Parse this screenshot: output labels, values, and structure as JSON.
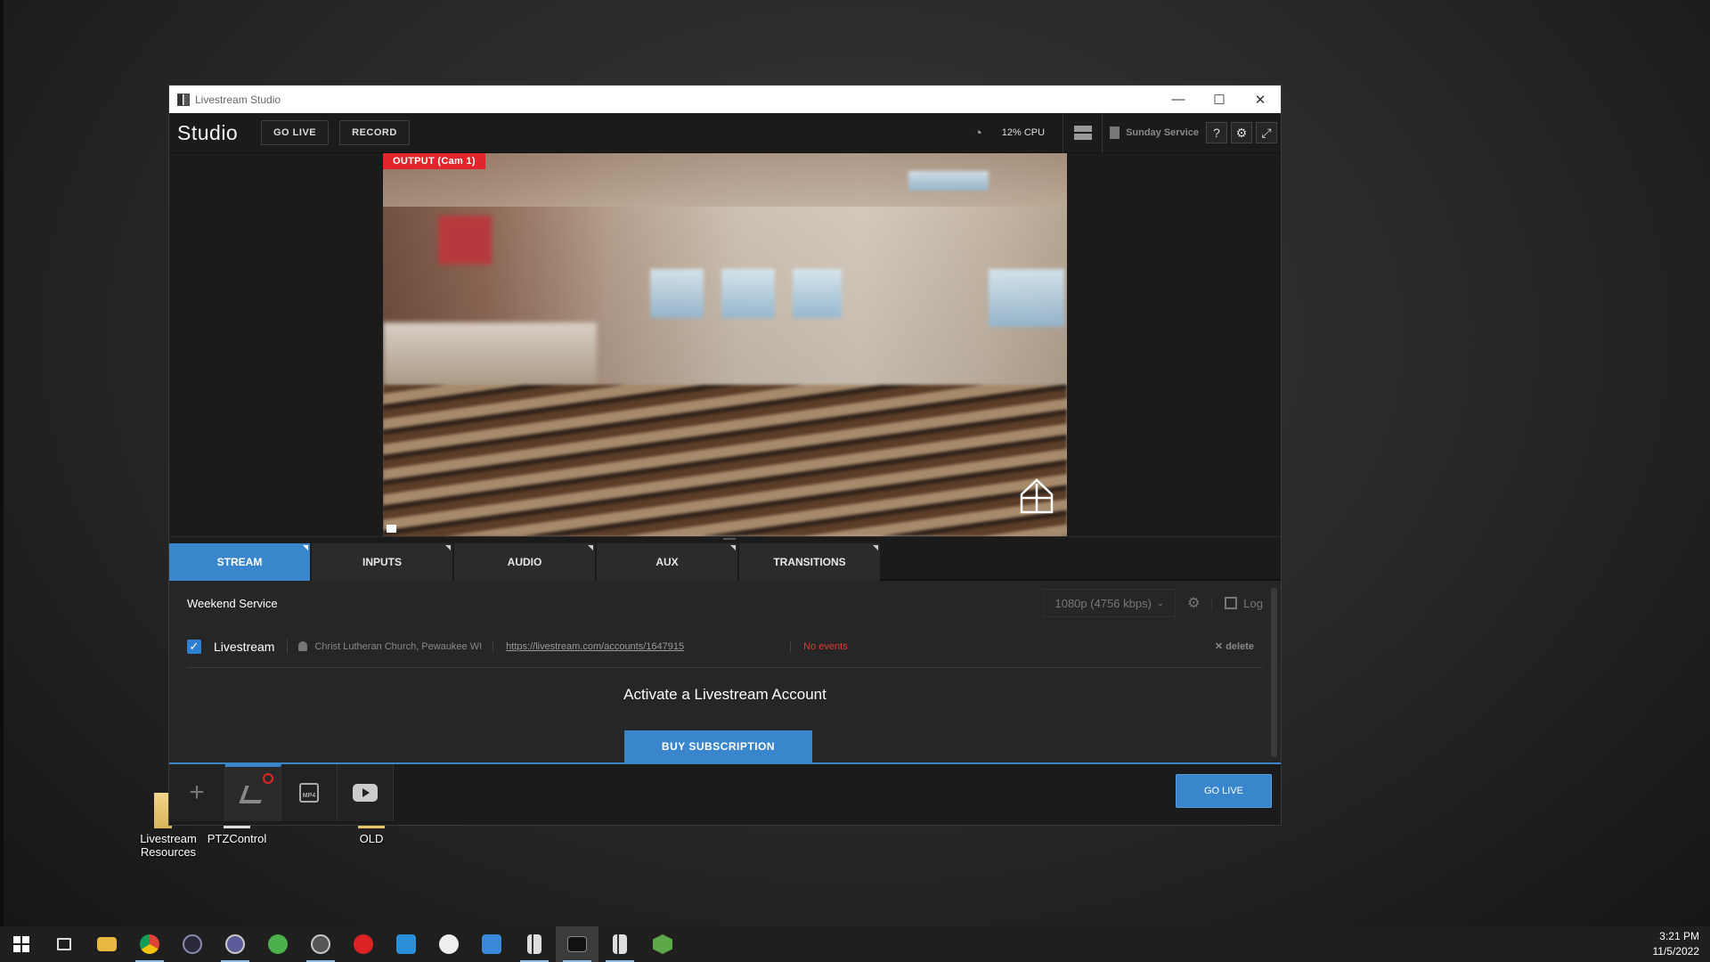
{
  "desktop": {
    "icons": [
      {
        "label_line1": "Livestream",
        "label_line2": "Resources"
      },
      {
        "label_line1": "PTZControl",
        "label_line2": ""
      },
      {
        "label_line1": "OLD",
        "label_line2": ""
      }
    ]
  },
  "window": {
    "title": "Livestream Studio",
    "controls": {
      "minimize": "—",
      "maximize": "☐",
      "close": "✕"
    }
  },
  "toolbar": {
    "studio_label": "Studio",
    "go_live_label": "GO LIVE",
    "record_label": "RECORD",
    "cpu": "12% CPU",
    "project_name": "Sunday Service"
  },
  "preview": {
    "output_label": "OUTPUT (Cam 1)"
  },
  "tabs": [
    "STREAM",
    "INPUTS",
    "AUDIO",
    "AUX",
    "TRANSITIONS"
  ],
  "stream": {
    "name": "Weekend Service",
    "quality": "1080p (4756 kbps)",
    "log_label": "Log",
    "destination": {
      "service": "Livestream",
      "account": "Christ Lutheran Church, Pewaukee WI",
      "url": "https://livestream.com/accounts/1647915",
      "status": "No events",
      "delete_label": "delete",
      "checked": true
    },
    "activate_text": "Activate a Livestream Account",
    "buy_label": "BUY SUBSCRIPTION"
  },
  "bottom": {
    "add_symbol": "+",
    "mp4_label": "MP4",
    "go_live_label": "GO LIVE"
  },
  "taskbar": {
    "time": "3:21 PM",
    "date": "11/5/2022"
  },
  "colors": {
    "accent": "#3a86cc",
    "output_red": "#e0262a",
    "no_events_red": "#e03a36"
  }
}
